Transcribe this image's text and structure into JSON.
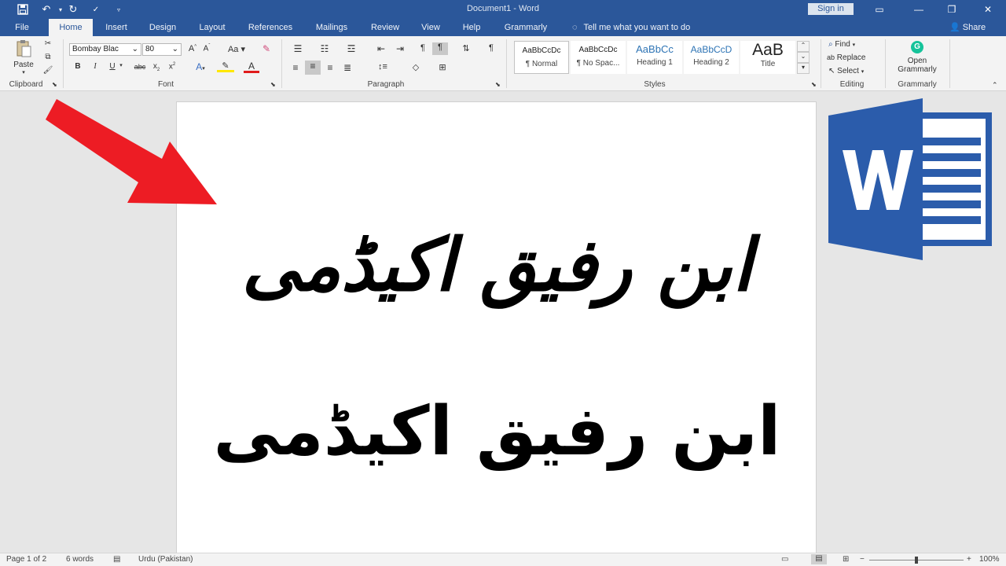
{
  "window": {
    "title": "Document1 - Word",
    "signin_label": "Sign in"
  },
  "tabs": [
    "File",
    "Home",
    "Insert",
    "Design",
    "Layout",
    "References",
    "Mailings",
    "Review",
    "View",
    "Help",
    "Grammarly"
  ],
  "tell_me": "Tell me what you want to do",
  "share_label": "Share",
  "ribbon": {
    "clipboard": {
      "paste_label": "Paste",
      "group_label": "Clipboard"
    },
    "font": {
      "font_name": "Bombay Blac",
      "font_size": "80",
      "change_case": "Aa",
      "group_label": "Font"
    },
    "paragraph": {
      "group_label": "Paragraph"
    },
    "styles": {
      "items": [
        {
          "sample": "AaBbCcDc",
          "name": "¶ Normal"
        },
        {
          "sample": "AaBbCcDc",
          "name": "¶ No Spac..."
        },
        {
          "sample": "AaBbCc",
          "name": "Heading 1"
        },
        {
          "sample": "AaBbCcD",
          "name": "Heading 2"
        },
        {
          "sample": "AaB",
          "name": "Title"
        }
      ],
      "group_label": "Styles"
    },
    "editing": {
      "find": "Find",
      "replace": "Replace",
      "select": "Select",
      "group_label": "Editing"
    },
    "grammarly": {
      "open_line1": "Open",
      "open_line2": "Grammarly",
      "group_label": "Grammarly"
    }
  },
  "document": {
    "line1": "ابن رفیق اکیڈمی",
    "line2": "ابن رفیق اکیڈمی"
  },
  "statusbar": {
    "page": "Page 1 of 2",
    "words": "6 words",
    "language": "Urdu (Pakistan)",
    "zoom": "100%"
  },
  "colors": {
    "word_blue": "#2b579a",
    "arrow_red": "#ed1c24",
    "logo_blue": "#2b5cab"
  }
}
